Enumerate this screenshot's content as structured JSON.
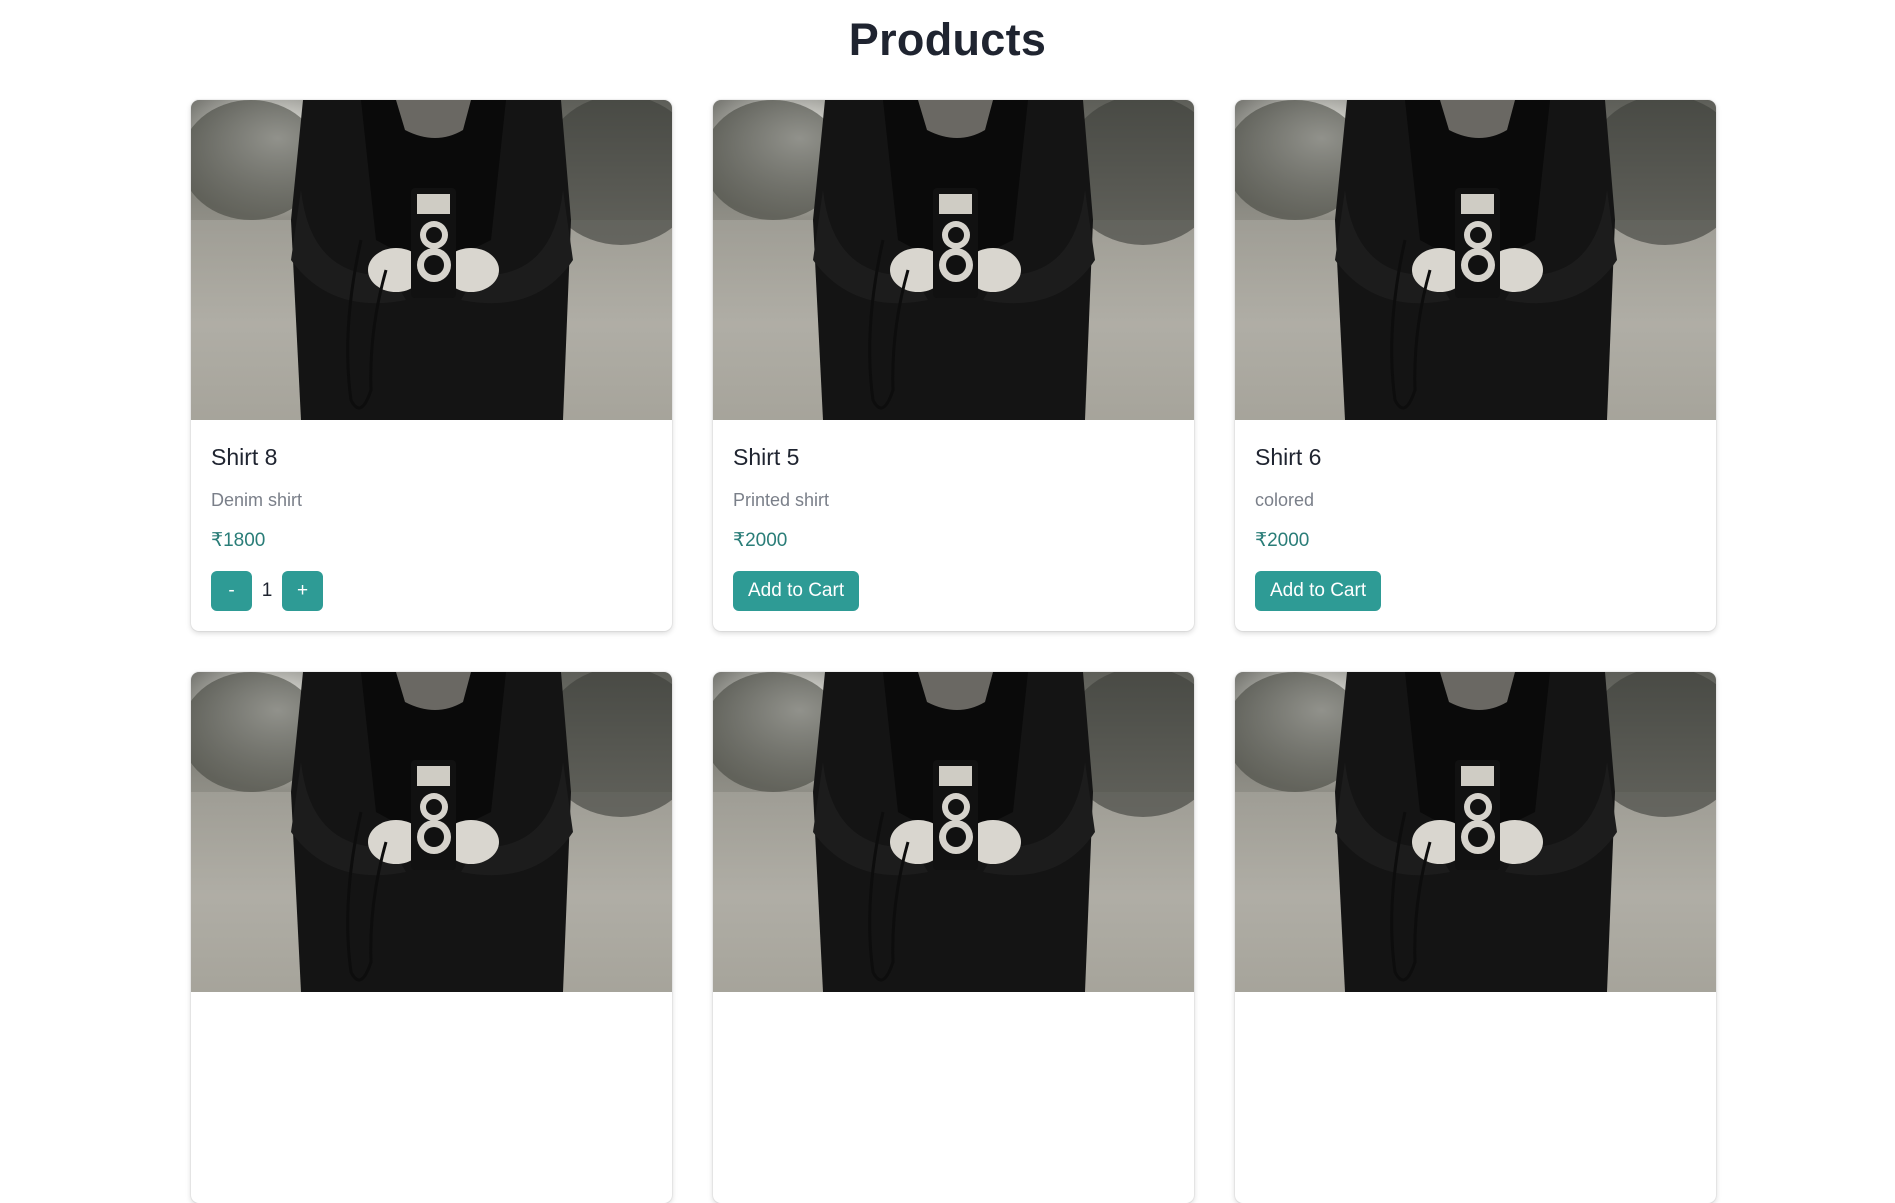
{
  "page": {
    "title": "Products"
  },
  "colors": {
    "accent": "#2e9b95",
    "price": "#2a7d78",
    "description": "#7a7f89",
    "title": "#1f2430"
  },
  "products": [
    {
      "name": "Shirt 8",
      "description": "Denim shirt",
      "price": "₹1800",
      "in_cart": true,
      "quantity": "1",
      "minus_label": "-",
      "plus_label": "+",
      "add_label": "Add to Cart",
      "image": "man-with-camera-photo"
    },
    {
      "name": "Shirt 5",
      "description": "Printed shirt",
      "price": "₹2000",
      "in_cart": false,
      "add_label": "Add to Cart",
      "image": "man-with-camera-photo"
    },
    {
      "name": "Shirt 6",
      "description": "colored",
      "price": "₹2000",
      "in_cart": false,
      "add_label": "Add to Cart",
      "image": "man-with-camera-photo"
    },
    {
      "name": "",
      "description": "",
      "price": "",
      "in_cart": false,
      "image": "man-with-camera-photo"
    },
    {
      "name": "",
      "description": "",
      "price": "",
      "in_cart": false,
      "image": "man-with-camera-photo"
    },
    {
      "name": "",
      "description": "",
      "price": "",
      "in_cart": false,
      "image": "man-with-camera-photo"
    }
  ]
}
